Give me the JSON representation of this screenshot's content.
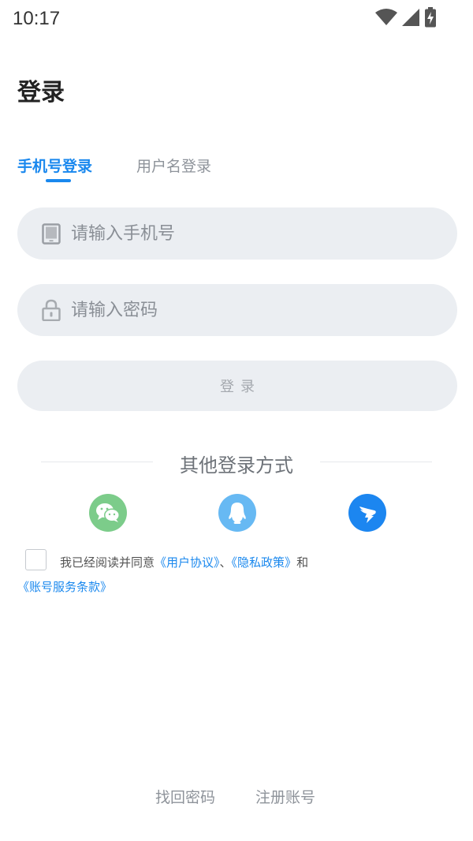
{
  "status_bar": {
    "time": "10:17",
    "icons": [
      "wifi-icon",
      "cellular-signal-icon",
      "battery-charging-icon"
    ]
  },
  "page": {
    "title": "登录"
  },
  "tabs": [
    {
      "label": "手机号登录",
      "active": true
    },
    {
      "label": "用户名登录",
      "active": false
    }
  ],
  "form": {
    "phone": {
      "placeholder": "请输入手机号",
      "value": "",
      "icon": "phone-icon"
    },
    "password": {
      "placeholder": "请输入密码",
      "value": "",
      "icon": "lock-icon"
    },
    "login_button": "登录"
  },
  "other_login": {
    "title": "其他登录方式",
    "providers": [
      {
        "name": "wechat-icon",
        "color": "#7ccc8a"
      },
      {
        "name": "qq-icon",
        "color": "#67b9f3"
      },
      {
        "name": "dingtalk-icon",
        "color": "#1c86f0"
      }
    ]
  },
  "agreement": {
    "checked": false,
    "prefix": "我已经阅读并同意",
    "user_agreement": "《用户协议》",
    "separator": "、",
    "privacy_policy": "《隐私政策》",
    "and": "和",
    "account_terms": "《账号服务条款》"
  },
  "footer": {
    "forgot_password": "找回密码",
    "register": "注册账号"
  },
  "colors": {
    "accent": "#1a88ee",
    "field_bg": "#ebeef2",
    "muted_text": "#8e939a"
  }
}
